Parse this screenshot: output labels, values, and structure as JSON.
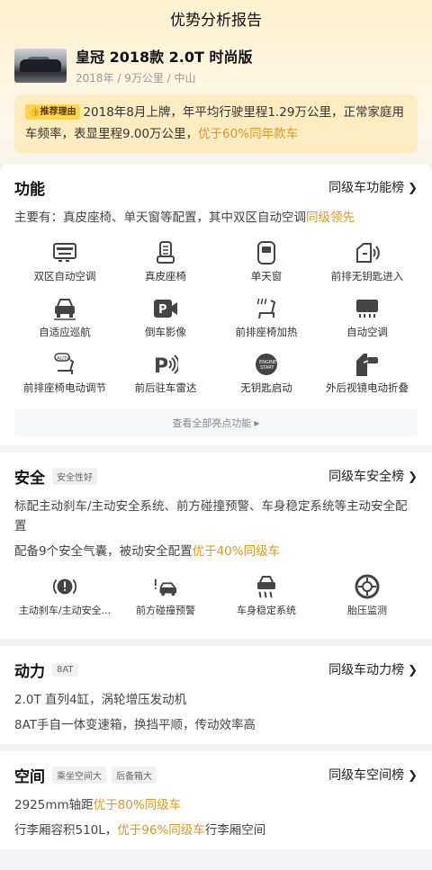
{
  "header": {
    "title": "优势分析报告"
  },
  "car": {
    "name": "皇冠 2018款 2.0T 时尚版",
    "meta": "2018年 / 9万公里 / 中山"
  },
  "reason": {
    "badge": "推荐理由",
    "text": "2018年8月上牌，年平均行驶里程1.29万公里，正常家庭用车频率，表显里程9.00万公里，",
    "highlight": "优于60%同年款车"
  },
  "function": {
    "title": "功能",
    "link": "同级车功能榜",
    "desc": "主要有：真皮座椅、单天窗等配置，其中双区自动空调",
    "desc_highlight": "同级领先",
    "features": [
      {
        "label": "双区自动空调",
        "icon": "dual-zone-ac-icon"
      },
      {
        "label": "真皮座椅",
        "icon": "leather-seat-icon"
      },
      {
        "label": "单天窗",
        "icon": "sunroof-icon"
      },
      {
        "label": "前排无钥匙进入",
        "icon": "keyless-entry-icon"
      },
      {
        "label": "自适应巡航",
        "icon": "adaptive-cruise-icon"
      },
      {
        "label": "倒车影像",
        "icon": "reverse-camera-icon"
      },
      {
        "label": "前排座椅加热",
        "icon": "seat-heating-icon"
      },
      {
        "label": "自动空调",
        "icon": "auto-ac-icon"
      },
      {
        "label": "前排座椅电动调节",
        "icon": "power-seat-icon"
      },
      {
        "label": "前后驻车雷达",
        "icon": "parking-radar-icon"
      },
      {
        "label": "无钥匙启动",
        "icon": "keyless-start-icon"
      },
      {
        "label": "外后视镜电动折叠",
        "icon": "mirror-fold-icon"
      }
    ],
    "show_all": "查看全部亮点功能"
  },
  "safety": {
    "title": "安全",
    "tag": "安全性好",
    "link": "同级车安全榜",
    "desc1": "标配主动刹车/主动安全系统、前方碰撞预警、车身稳定系统等主动安全配置",
    "desc2": "配备9个安全气囊，被动安全配置",
    "desc2_highlight": "优于40%同级车",
    "features": [
      {
        "label": "主动刹车/主动安全...",
        "icon": "active-brake-icon"
      },
      {
        "label": "前方碰撞预警",
        "icon": "collision-warning-icon"
      },
      {
        "label": "车身稳定系统",
        "icon": "stability-control-icon"
      },
      {
        "label": "胎压监测",
        "icon": "tire-pressure-icon"
      }
    ]
  },
  "power": {
    "title": "动力",
    "tag": "8AT",
    "link": "同级车动力榜",
    "line1": "2.0T 直列4缸，涡轮增压发动机",
    "line2": "8AT手自一体变速箱，换挡平顺，传动效率高"
  },
  "space": {
    "title": "空间",
    "tags": [
      "乘坐空间大",
      "后备箱大"
    ],
    "link": "同级车空间榜",
    "line1": "2925mm轴距",
    "line1_highlight": "优于80%同级车",
    "line2": "行李厢容积510L，",
    "line2_highlight": "优于96%同级车",
    "line2_tail": "行李厢空间"
  },
  "colors": {
    "highlight": "#d69a22",
    "badge": "#fbd453",
    "bg_top": "#fdf1cf"
  }
}
